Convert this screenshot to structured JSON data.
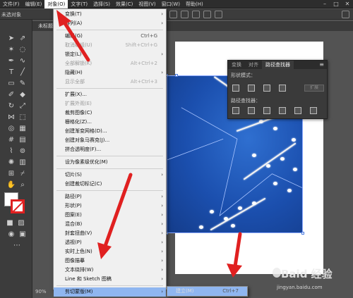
{
  "menubar": {
    "items": [
      "文件(F)",
      "编辑(E)",
      "对象(O)",
      "文字(T)",
      "选择(S)",
      "效果(C)",
      "视图(V)",
      "窗口(W)",
      "帮助(H)"
    ],
    "active_index": 2,
    "window_controls": [
      "minimize-icon",
      "maximize-icon",
      "close-icon"
    ]
  },
  "control_bar": {
    "label": "未选对象"
  },
  "document_tab": {
    "label": "未标题"
  },
  "status": {
    "zoom": "90%"
  },
  "object_menu": [
    {
      "label": "变换(T)",
      "shortcut": "",
      "submenu": true,
      "disabled": false
    },
    {
      "label": "排列(A)",
      "shortcut": "",
      "submenu": true,
      "disabled": false
    },
    {
      "sep": true
    },
    {
      "label": "编组(G)",
      "shortcut": "Ctrl+G",
      "submenu": false,
      "disabled": false
    },
    {
      "label": "取消编组(U)",
      "shortcut": "Shift+Ctrl+G",
      "submenu": false,
      "disabled": true
    },
    {
      "label": "锁定(L)",
      "shortcut": "",
      "submenu": true,
      "disabled": false
    },
    {
      "label": "全部解锁(K)",
      "shortcut": "Alt+Ctrl+2",
      "submenu": false,
      "disabled": true
    },
    {
      "label": "隐藏(H)",
      "shortcut": "",
      "submenu": true,
      "disabled": false
    },
    {
      "label": "显示全部",
      "shortcut": "Alt+Ctrl+3",
      "submenu": false,
      "disabled": true
    },
    {
      "sep": true
    },
    {
      "label": "扩展(X)...",
      "shortcut": "",
      "submenu": false,
      "disabled": false
    },
    {
      "label": "扩展外观(E)",
      "shortcut": "",
      "submenu": false,
      "disabled": true
    },
    {
      "label": "裁剪图像(C)",
      "shortcut": "",
      "submenu": false,
      "disabled": false
    },
    {
      "label": "栅格化(Z)...",
      "shortcut": "",
      "submenu": false,
      "disabled": false
    },
    {
      "label": "创建渐变网格(D)...",
      "shortcut": "",
      "submenu": false,
      "disabled": false
    },
    {
      "label": "创建对象马赛克(J)...",
      "shortcut": "",
      "submenu": false,
      "disabled": false
    },
    {
      "label": "拼合透明度(F)...",
      "shortcut": "",
      "submenu": false,
      "disabled": false
    },
    {
      "sep": true
    },
    {
      "label": "设为像素级优化(M)",
      "shortcut": "",
      "submenu": false,
      "disabled": false
    },
    {
      "sep": true
    },
    {
      "label": "切片(S)",
      "shortcut": "",
      "submenu": true,
      "disabled": false
    },
    {
      "label": "创建裁切标记(C)",
      "shortcut": "",
      "submenu": false,
      "disabled": false
    },
    {
      "sep": true
    },
    {
      "label": "路径(P)",
      "shortcut": "",
      "submenu": true,
      "disabled": false
    },
    {
      "label": "形状(P)",
      "shortcut": "",
      "submenu": true,
      "disabled": false
    },
    {
      "label": "图案(E)",
      "shortcut": "",
      "submenu": true,
      "disabled": false
    },
    {
      "label": "混合(B)",
      "shortcut": "",
      "submenu": true,
      "disabled": false
    },
    {
      "label": "封套扭曲(V)",
      "shortcut": "",
      "submenu": true,
      "disabled": false
    },
    {
      "label": "透视(P)",
      "shortcut": "",
      "submenu": true,
      "disabled": false
    },
    {
      "label": "实时上色(N)",
      "shortcut": "",
      "submenu": true,
      "disabled": false
    },
    {
      "label": "图像描摹",
      "shortcut": "",
      "submenu": true,
      "disabled": false
    },
    {
      "label": "文本绕排(W)",
      "shortcut": "",
      "submenu": true,
      "disabled": false
    },
    {
      "label": "Line 和 Sketch 图稿",
      "shortcut": "",
      "submenu": true,
      "disabled": false
    },
    {
      "sep": true
    },
    {
      "label": "剪切蒙版(M)",
      "shortcut": "",
      "submenu": true,
      "disabled": false,
      "highlight": true
    }
  ],
  "clip_submenu": {
    "label": "建立(M)",
    "shortcut": "Ctrl+7"
  },
  "pathfinder_panel": {
    "tabs": [
      "变换",
      "对齐",
      "路径查找器"
    ],
    "active_tab": 2,
    "shape_modes_label": "形状模式：",
    "pathfinders_label": "路径查找器：",
    "expand_label": "扩展"
  },
  "watermark": {
    "brand": "Baid 经验",
    "url": "jingyan.baidu.com"
  },
  "colors": {
    "annotation": "#e02020",
    "menu_highlight": "#8fb6f0",
    "photo_blue": "#1b4fae"
  }
}
